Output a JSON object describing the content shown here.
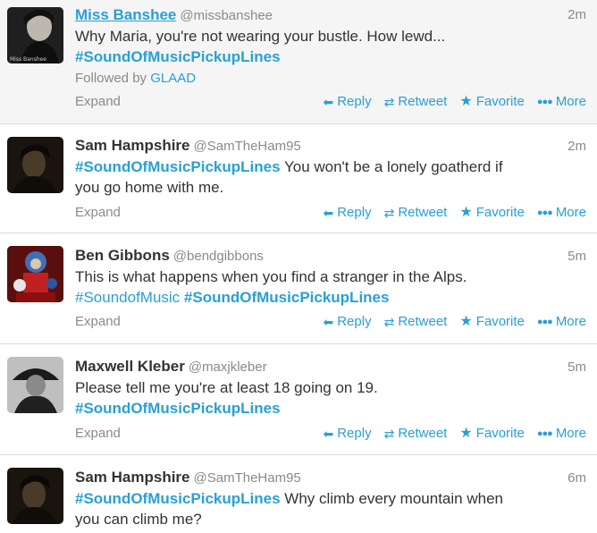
{
  "colors": {
    "link": "#2a9fd6",
    "muted": "#8a8a8a",
    "text": "#333333",
    "highlight_bg": "#f5f5f5"
  },
  "icons": {
    "reply": "reply-arrow-icon",
    "retweet": "retweet-icon",
    "favorite": "star-icon",
    "more": "more-dots-icon"
  },
  "actions": {
    "expand": "Expand",
    "reply": "Reply",
    "retweet": "Retweet",
    "favorite": "Favorite",
    "more": "More"
  },
  "tweets": [
    {
      "name": "Miss Banshee",
      "handle": "@missbanshee",
      "time": "2m",
      "line1": "Why Maria, you're not wearing your bustle. How lewd...",
      "hashtag": "#SoundOfMusicPickupLines",
      "followed_by_label": "Followed by",
      "followed_by": "GLAAD",
      "avatar_caption": "Miss Banshee"
    },
    {
      "name": "Sam Hampshire",
      "handle": "@SamTheHam95",
      "time": "2m",
      "hashtag": "#SoundOfMusicPickupLines",
      "after_tag": " You won't be a lonely goatherd if",
      "line2": "you go home with me."
    },
    {
      "name": "Ben Gibbons",
      "handle": "@bendgibbons",
      "time": "5m",
      "line1": "This is what happens when you find a stranger in the Alps.",
      "tag_plain": "#SoundofMusic",
      "hashtag": "#SoundOfMusicPickupLines"
    },
    {
      "name": "Maxwell Kleber",
      "handle": "@maxjkleber",
      "time": "5m",
      "line1": "Please tell me you're at least 18 going on 19.",
      "hashtag": "#SoundOfMusicPickupLines"
    },
    {
      "name": "Sam Hampshire",
      "handle": "@SamTheHam95",
      "time": "6m",
      "hashtag": "#SoundOfMusicPickupLines",
      "after_tag": " Why climb every mountain when",
      "line2": "you can climb me?"
    }
  ]
}
